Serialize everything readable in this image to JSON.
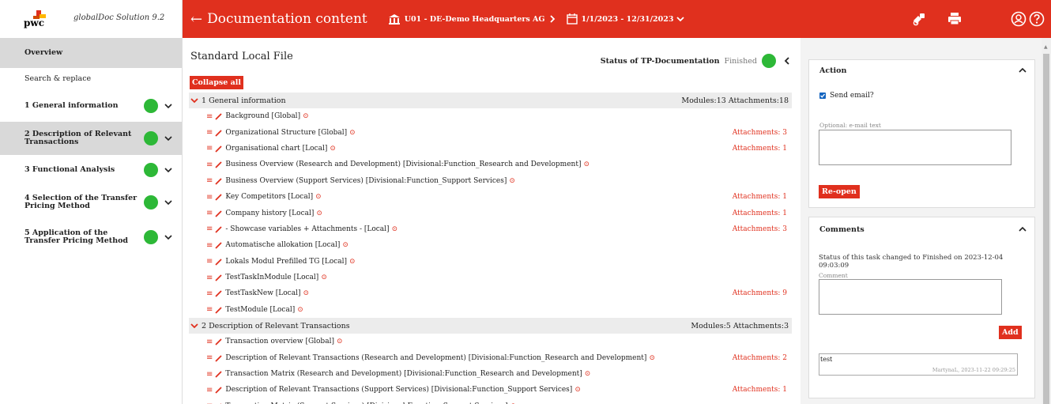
{
  "app": {
    "brand": "pwc",
    "name": "globalDoc Solution 9.2"
  },
  "sidebar": {
    "items": [
      {
        "label": "Overview"
      },
      {
        "label": "Search & replace"
      },
      {
        "label": "1 General information"
      },
      {
        "label": "2 Description of Relevant Transactions"
      },
      {
        "label": "3 Functional Analysis"
      },
      {
        "label": "4 Selection of the Transfer Pricing Method"
      },
      {
        "label": "5 Application of the Transfer Pricing Method"
      }
    ]
  },
  "header": {
    "back_label": "Documentation content",
    "entity": "U01 - DE-Demo Headquarters AG",
    "period": "1/1/2023 - 12/31/2023"
  },
  "main": {
    "title": "Standard Local File",
    "status_label": "Status of TP-Documentation",
    "status_value": "Finished",
    "collapse_label": "Collapse all",
    "sections": [
      {
        "name": "1 General information",
        "meta": "Modules:13  Attachments:18",
        "rows": [
          {
            "name": "Background [Global]",
            "att": ""
          },
          {
            "name": "Organizational Structure [Global]",
            "att": "Attachments: 3"
          },
          {
            "name": "Organisational chart [Local]",
            "att": "Attachments: 1"
          },
          {
            "name": "Business Overview (Research and Development) [Divisional:Function_Research and Development]",
            "att": ""
          },
          {
            "name": "Business Overview (Support Services) [Divisional:Function_Support Services]",
            "att": ""
          },
          {
            "name": "Key Competitors [Local]",
            "att": "Attachments: 1"
          },
          {
            "name": "Company history [Local]",
            "att": "Attachments: 1"
          },
          {
            "name": "- Showcase variables + Attachments - [Local]",
            "att": "Attachments: 3"
          },
          {
            "name": "Automatische allokation [Local]",
            "att": ""
          },
          {
            "name": "Lokals Modul Prefilled TG [Local]",
            "att": ""
          },
          {
            "name": "TestTaskInModule [Local]",
            "att": ""
          },
          {
            "name": "TestTaskNew [Local]",
            "att": "Attachments: 9"
          },
          {
            "name": "TestModule [Local]",
            "att": ""
          }
        ]
      },
      {
        "name": "2 Description of Relevant Transactions",
        "meta": "Modules:5  Attachments:3",
        "rows": [
          {
            "name": "Transaction overview [Global]",
            "att": ""
          },
          {
            "name": "Description of Relevant Transactions (Research and Development) [Divisional:Function_Research and Development]",
            "att": "Attachments: 2"
          },
          {
            "name": "Transaction Matrix (Research and Development) [Divisional:Function_Research and Development]",
            "att": ""
          },
          {
            "name": "Description of Relevant Transactions (Support Services) [Divisional:Function_Support Services]",
            "att": "Attachments: 1"
          },
          {
            "name": "Transaction Matrix (Support Services) [Divisional:Function_Support Services]",
            "att": ""
          }
        ]
      }
    ]
  },
  "action_panel": {
    "title": "Action",
    "send_email_label": "Send email?",
    "email_placeholder": "Optional: e-mail text",
    "reopen_label": "Re-open"
  },
  "comments_panel": {
    "title": "Comments",
    "status_note": "Status of this task changed to Finished on 2023-12-04 09:03:09",
    "comment_label": "Comment",
    "add_label": "Add",
    "existing_comment": "test",
    "existing_meta": "MartynaL, 2023-11-22 09:29:25"
  },
  "colors": {
    "brand_red": "#e0301e",
    "status_green": "#2db837"
  }
}
